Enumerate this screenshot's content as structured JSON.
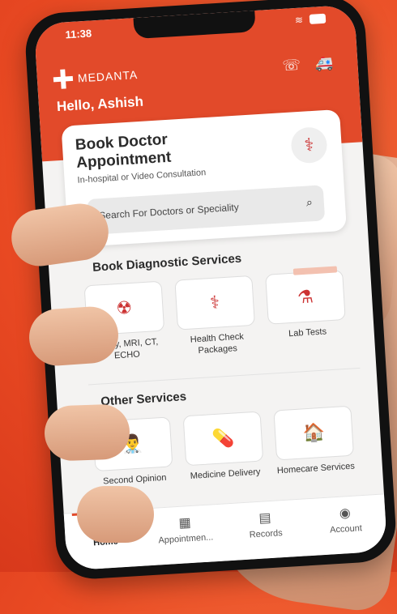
{
  "status": {
    "time": "11:38"
  },
  "brand": {
    "name": "MEDANTA"
  },
  "greeting": "Hello, Ashish",
  "book": {
    "title": "Book Doctor Appointment",
    "subtitle": "In-hospital or Video Consultation",
    "search_placeholder": "Search For Doctors or Speciality"
  },
  "diagnostics": {
    "title": "Book Diagnostic Services",
    "items": [
      {
        "label": "X-Ray, MRI, CT, ECHO",
        "icon": "xray-icon"
      },
      {
        "label": "Health Check Packages",
        "icon": "stethoscope-icon"
      },
      {
        "label": "Lab Tests",
        "icon": "flask-icon"
      }
    ]
  },
  "other": {
    "title": "Other Services",
    "items": [
      {
        "label": "Second Opinion",
        "icon": "doctor-icon"
      },
      {
        "label": "Medicine Delivery",
        "icon": "pills-icon"
      },
      {
        "label": "Homecare Services",
        "icon": "homecare-icon"
      }
    ]
  },
  "tabs": [
    {
      "label": "Home",
      "icon": "home-icon",
      "active": true
    },
    {
      "label": "Appointmen...",
      "icon": "calendar-icon"
    },
    {
      "label": "Records",
      "icon": "records-icon"
    },
    {
      "label": "Account",
      "icon": "account-icon"
    }
  ],
  "colors": {
    "brand": "#e24a2a",
    "background": "#e94a23"
  }
}
